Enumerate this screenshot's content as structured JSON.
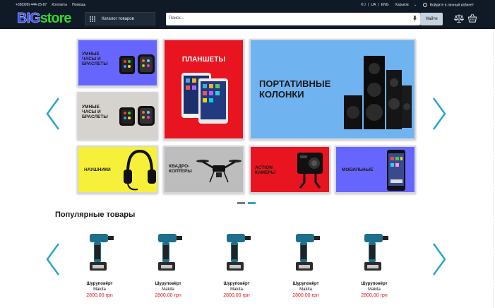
{
  "topbar": {
    "phone": "+38(098) 444-25-87",
    "contacts": "Контакты",
    "help": "Помощь",
    "lang_ru": "RU",
    "lang_sep": "|",
    "lang_ua": "UA",
    "lang_en": "ENG",
    "city": "Харьков",
    "login": "Войдите в личный кабинет"
  },
  "header": {
    "logo_big": "BIG",
    "logo_store": "store",
    "catalog_label": "Каталог товаров",
    "search_placeholder": "Поиск...",
    "search_button": "Найти"
  },
  "banner": {
    "tiles": [
      {
        "label": "УМНЫЕ ЧАСЫ И БРАСЛЕТЫ",
        "color": "#6666ff"
      },
      {
        "label": "ПЛАНШЕТЫ",
        "color": "#e8141f"
      },
      {
        "label": "ПОРТАТИВНЫЕ КОЛОНКИ",
        "color": "#6fb3f1"
      },
      {
        "label": "УМНЫЕ ЧАСЫ И БРАСЛЕТЫ",
        "color": "#d6d2ce"
      },
      {
        "label": "НАУШНИКИ",
        "color": "#f6f03a"
      },
      {
        "label": "КВАДРО-КОПТЕРЫ",
        "color": "#bdbdbd"
      },
      {
        "label": "ACTION КАМЕРЫ",
        "color": "#e8141f"
      },
      {
        "label": "МОБИЛЬНЫЕ",
        "color": "#6666ff"
      }
    ],
    "slides_total": 2,
    "active_slide": 2
  },
  "popular": {
    "title": "Популярные товары",
    "products": [
      {
        "name": "Шуруповёрт",
        "brand": "Makita",
        "price": "2800,00 грн"
      },
      {
        "name": "Шуруповёрт",
        "brand": "Makita",
        "price": "2800,00 грн"
      },
      {
        "name": "Шуруповёрт",
        "brand": "Makita",
        "price": "2800,00 грн"
      },
      {
        "name": "Шуруповёрт",
        "brand": "Makita",
        "price": "2800,00 грн"
      },
      {
        "name": "Шуруповёрт",
        "brand": "Makita",
        "price": "2800,00 грн"
      }
    ]
  },
  "colors": {
    "header_bg": "#101926",
    "accent": "#2aa5c6",
    "price": "#e11a1a",
    "logo_blue": "#3a4dff",
    "logo_green": "#34d52d"
  },
  "icons": [
    "grid-icon",
    "mic-icon",
    "compare-icon",
    "cart-icon",
    "user-icon",
    "chevron-left-icon",
    "chevron-right-icon"
  ]
}
